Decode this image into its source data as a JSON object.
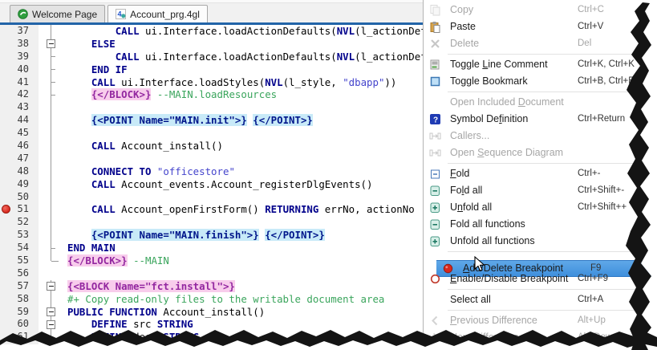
{
  "tabs": [
    {
      "label": "Welcome Page",
      "icon": "welcome-page-icon",
      "active": false
    },
    {
      "label": "Account_prg.4gl",
      "icon": "4gl-file-icon",
      "active": true
    }
  ],
  "editor": {
    "breakpoint_line": 51,
    "lines": [
      {
        "n": 37,
        "fold": "line",
        "seg": [
          [
            "pl",
            "        "
          ],
          [
            "kw",
            "CALL"
          ],
          [
            "pl",
            " ui.Interface.loadActionDefaults("
          ],
          [
            "kw",
            "NVL"
          ],
          [
            "pl",
            "(l_actionDefaults"
          ]
        ]
      },
      {
        "n": 38,
        "fold": "box",
        "seg": [
          [
            "pl",
            "    "
          ],
          [
            "kw",
            "ELSE"
          ]
        ]
      },
      {
        "n": 39,
        "fold": "tick",
        "seg": [
          [
            "pl",
            "        "
          ],
          [
            "kw",
            "CALL"
          ],
          [
            "pl",
            " ui.Interface.loadActionDefaults("
          ],
          [
            "kw",
            "NVL"
          ],
          [
            "pl",
            "(l_actionDefaults"
          ]
        ]
      },
      {
        "n": 40,
        "fold": "tick",
        "seg": [
          [
            "pl",
            "    "
          ],
          [
            "kw",
            "END IF"
          ]
        ]
      },
      {
        "n": 41,
        "fold": "tick",
        "seg": [
          [
            "pl",
            "    "
          ],
          [
            "kw",
            "CALL"
          ],
          [
            "pl",
            " ui.Interface.loadStyles("
          ],
          [
            "kw",
            "NVL"
          ],
          [
            "pl",
            "(l_style, "
          ],
          [
            "str",
            "\"dbapp\""
          ],
          [
            "pl",
            "))"
          ]
        ]
      },
      {
        "n": 42,
        "fold": "tick",
        "seg": [
          [
            "pl",
            "    "
          ],
          [
            "blk",
            "{</BLOCK>}"
          ],
          [
            "pl",
            " "
          ],
          [
            "com",
            "--MAIN.loadResources"
          ]
        ]
      },
      {
        "n": 43,
        "fold": "line",
        "seg": []
      },
      {
        "n": 44,
        "fold": "line",
        "seg": [
          [
            "pl",
            "    "
          ],
          [
            "pnt",
            "{<POINT Name=\"MAIN.init\">}"
          ],
          [
            "pl",
            " "
          ],
          [
            "pnt",
            "{</POINT>}"
          ]
        ]
      },
      {
        "n": 45,
        "fold": "line",
        "seg": []
      },
      {
        "n": 46,
        "fold": "line",
        "seg": [
          [
            "pl",
            "    "
          ],
          [
            "kw",
            "CALL"
          ],
          [
            "pl",
            " Account_install()"
          ]
        ]
      },
      {
        "n": 47,
        "fold": "line",
        "seg": []
      },
      {
        "n": 48,
        "fold": "line",
        "seg": [
          [
            "pl",
            "    "
          ],
          [
            "kw",
            "CONNECT TO"
          ],
          [
            "pl",
            " "
          ],
          [
            "str",
            "\"officestore\""
          ]
        ]
      },
      {
        "n": 49,
        "fold": "line",
        "seg": [
          [
            "pl",
            "    "
          ],
          [
            "kw",
            "CALL"
          ],
          [
            "pl",
            " Account_events.Account_registerDlgEvents()"
          ]
        ]
      },
      {
        "n": 50,
        "fold": "line",
        "seg": []
      },
      {
        "n": 51,
        "fold": "line",
        "bp": true,
        "seg": [
          [
            "pl",
            "    "
          ],
          [
            "kw",
            "CALL"
          ],
          [
            "pl",
            " Account_openFirstForm() "
          ],
          [
            "kw",
            "RETURNING"
          ],
          [
            "pl",
            " errNo, actionNo"
          ]
        ]
      },
      {
        "n": 52,
        "fold": "line",
        "seg": []
      },
      {
        "n": 53,
        "fold": "line",
        "seg": [
          [
            "pl",
            "    "
          ],
          [
            "pnt",
            "{<POINT Name=\"MAIN.finish\">}"
          ],
          [
            "pl",
            " "
          ],
          [
            "pnt",
            "{</POINT>}"
          ]
        ]
      },
      {
        "n": 54,
        "fold": "tick",
        "seg": [
          [
            "kw",
            "END MAIN"
          ]
        ]
      },
      {
        "n": 55,
        "fold": "end",
        "seg": [
          [
            "blk",
            "{</BLOCK>}"
          ],
          [
            "pl",
            " "
          ],
          [
            "com",
            "--MAIN"
          ]
        ]
      },
      {
        "n": 56,
        "fold": "none",
        "seg": []
      },
      {
        "n": 57,
        "fold": "box",
        "seg": [
          [
            "blk",
            "{<BLOCK Name=\"fct.install\">}"
          ]
        ]
      },
      {
        "n": 58,
        "fold": "line",
        "seg": [
          [
            "com",
            "#+ Copy read-only files to the writable document area"
          ]
        ]
      },
      {
        "n": 59,
        "fold": "box",
        "seg": [
          [
            "kw",
            "PUBLIC FUNCTION"
          ],
          [
            "pl",
            " Account_install()"
          ]
        ]
      },
      {
        "n": 60,
        "fold": "box",
        "seg": [
          [
            "pl",
            "    "
          ],
          [
            "kw",
            "DEFINE"
          ],
          [
            "pl",
            " src "
          ],
          [
            "kw",
            "STRING"
          ]
        ]
      },
      {
        "n": 61,
        "fold": "line",
        "seg": [
          [
            "pl",
            "    "
          ],
          [
            "kw",
            "DEFINE"
          ],
          [
            "pl",
            " dest "
          ],
          [
            "kw",
            "STRING"
          ]
        ]
      }
    ]
  },
  "menu": {
    "items": [
      {
        "label": "Copy",
        "shortcut": "Ctrl+C",
        "icon": "copy-icon",
        "enabled": false,
        "u": -1
      },
      {
        "label": "Paste",
        "shortcut": "Ctrl+V",
        "icon": "paste-icon",
        "enabled": true,
        "u": -1
      },
      {
        "label": "Delete",
        "shortcut": "Del",
        "icon": "delete-icon",
        "enabled": false,
        "u": -1
      },
      {
        "sep": true
      },
      {
        "label": "Toggle Line Comment",
        "shortcut": "Ctrl+K, Ctrl+K",
        "icon": "line-comment-icon",
        "enabled": true,
        "u": 7
      },
      {
        "label": "Toggle Bookmark",
        "shortcut": "Ctrl+B, Ctrl+B",
        "icon": "bookmark-icon",
        "enabled": true,
        "u": -1
      },
      {
        "sep": true
      },
      {
        "label": "Open Included Document",
        "shortcut": "",
        "icon": "",
        "enabled": false,
        "u": 14
      },
      {
        "label": "Symbol Definition",
        "shortcut": "Ctrl+Return",
        "icon": "symbol-definition-icon",
        "enabled": true,
        "u": 9
      },
      {
        "label": "Callers...",
        "shortcut": "",
        "icon": "callers-icon",
        "enabled": false,
        "u": -1
      },
      {
        "label": "Open Sequence Diagram",
        "shortcut": "",
        "icon": "sequence-diagram-icon",
        "enabled": false,
        "u": 5
      },
      {
        "sep": true
      },
      {
        "label": "Fold",
        "shortcut": "Ctrl+-",
        "icon": "fold-icon",
        "enabled": true,
        "u": 0
      },
      {
        "label": "Fold all",
        "shortcut": "Ctrl+Shift+-",
        "icon": "fold-all-icon",
        "enabled": true,
        "u": 2
      },
      {
        "label": "Unfold all",
        "shortcut": "Ctrl+Shift++",
        "icon": "unfold-all-icon",
        "enabled": true,
        "u": 1
      },
      {
        "label": "Fold all functions",
        "shortcut": "",
        "icon": "fold-all-icon",
        "enabled": true,
        "u": -1
      },
      {
        "label": "Unfold all functions",
        "shortcut": "",
        "icon": "unfold-all-icon",
        "enabled": true,
        "u": -1
      },
      {
        "sep": true
      },
      {
        "label": "Add/Delete Breakpoint",
        "shortcut": "F9",
        "icon": "breakpoint-filled-icon",
        "enabled": true,
        "u": 0,
        "highlighted": true
      },
      {
        "label": "Enable/Disable Breakpoint",
        "shortcut": "Ctrl+F9",
        "icon": "breakpoint-outline-icon",
        "enabled": true,
        "u": 0
      },
      {
        "sep": true
      },
      {
        "label": "Select all",
        "shortcut": "Ctrl+A",
        "icon": "",
        "enabled": true,
        "u": -1
      },
      {
        "sep": true
      },
      {
        "label": "Previous Difference",
        "shortcut": "Alt+Up",
        "icon": "chevron-left-icon",
        "enabled": false,
        "u": 0
      },
      {
        "label": "Next Difference",
        "shortcut": "Alt+Down",
        "icon": "chevron-right-icon",
        "enabled": false,
        "u": 0
      }
    ]
  },
  "colors": {
    "tab_underline": "#2264a8",
    "menu_highlight": "#4f9ee0",
    "breakpoint_red": "#d8281e",
    "keyword": "#00008b",
    "string": "#4444cc",
    "comment": "#3aa55c",
    "block_tag_bg": "#f8cdec",
    "block_tag_fg": "#9327a0",
    "point_tag_bg": "#c8eaf8",
    "point_tag_fg": "#00168b"
  }
}
